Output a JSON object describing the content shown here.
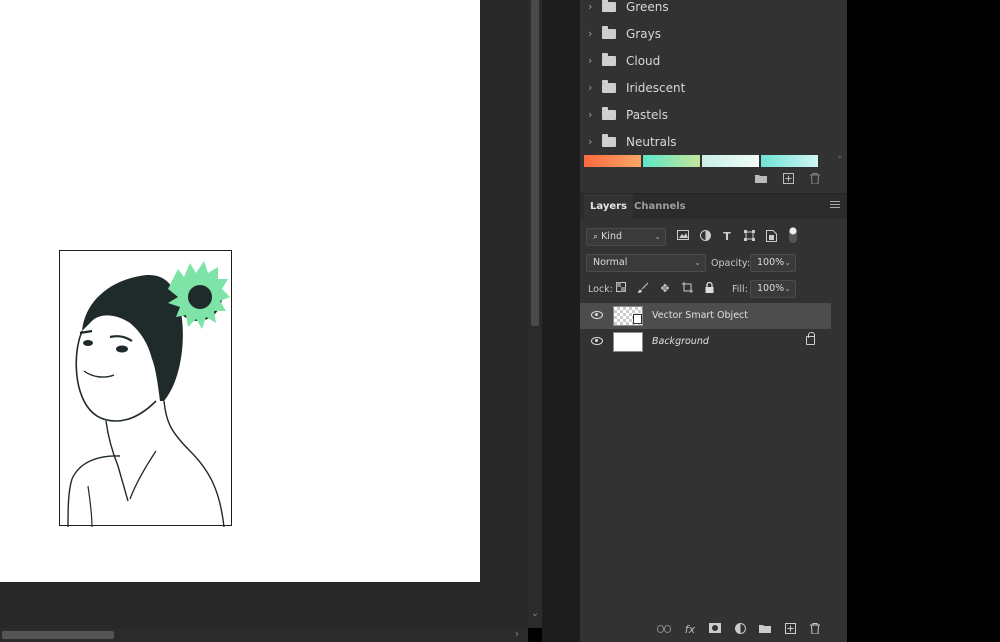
{
  "gradient_groups": [
    "Greens",
    "Grays",
    "Cloud",
    "Iridescent",
    "Pastels",
    "Neutrals"
  ],
  "gradient_swatches": [
    {
      "from": "#ff6a3d",
      "to": "#f7a76a"
    },
    {
      "from": "#5ee6c8",
      "to": "#c3e59a"
    },
    {
      "from": "#c8f0e8",
      "to": "#f2fbf8"
    },
    {
      "from": "#6fe3d6",
      "to": "#cff6f2"
    }
  ],
  "layers_panel": {
    "tabs": [
      "Layers",
      "Channels"
    ],
    "filter_kind": "Kind",
    "blend_mode": "Normal",
    "opacity_label": "Opacity:",
    "opacity_value": "100%",
    "lock_label": "Lock:",
    "fill_label": "Fill:",
    "fill_value": "100%",
    "layers": [
      {
        "name": "Vector Smart Object",
        "selected": true
      },
      {
        "name": "Background",
        "locked": true
      }
    ]
  },
  "colors": {
    "panel_bg": "#323232",
    "canvas_bg": "#282828",
    "accent_green": "#7ee3a6"
  }
}
